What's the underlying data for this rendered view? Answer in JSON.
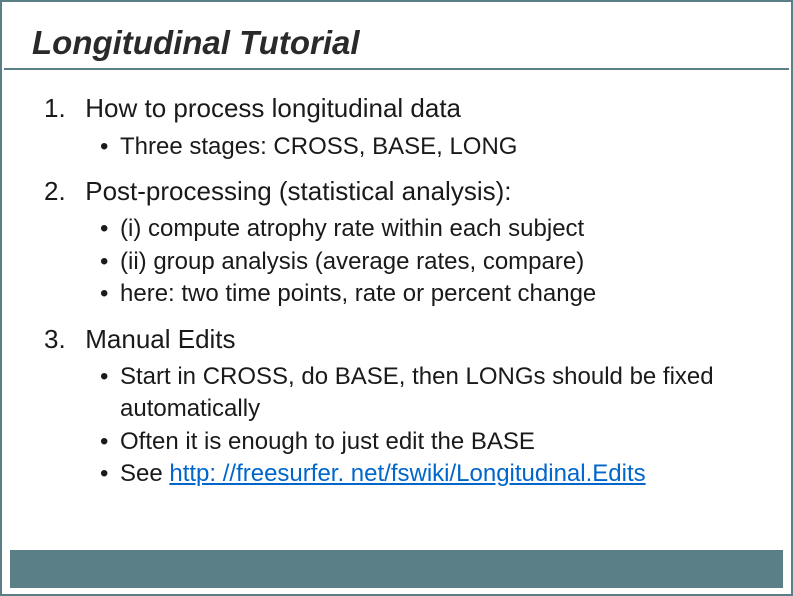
{
  "title": "Longitudinal Tutorial",
  "items": [
    {
      "heading": "How to process longitudinal data",
      "bullets": [
        {
          "text": "Three stages: CROSS, BASE, LONG"
        }
      ]
    },
    {
      "heading": "Post-processing (statistical analysis):",
      "bullets": [
        {
          "text": "(i) compute atrophy rate within each subject"
        },
        {
          "text": "(ii) group analysis (average rates, compare)"
        },
        {
          "text": "here: two time points, rate or percent change"
        }
      ]
    },
    {
      "heading": "Manual Edits",
      "bullets": [
        {
          "text": "Start in CROSS, do BASE, then LONGs should be fixed automatically"
        },
        {
          "text": "Often it is enough to just edit the BASE"
        },
        {
          "prefix": "See ",
          "link": "http: //freesurfer. net/fswiki/Longitudinal.Edits"
        }
      ]
    }
  ]
}
